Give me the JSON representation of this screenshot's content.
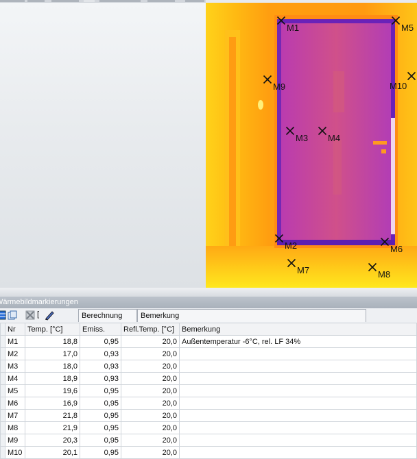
{
  "thermal_image": {
    "markers": [
      {
        "id": "M1",
        "label": "M1"
      },
      {
        "id": "M5",
        "label": "M5"
      },
      {
        "id": "M9",
        "label": "M9"
      },
      {
        "id": "M10",
        "label": "M10"
      },
      {
        "id": "M3",
        "label": "M3"
      },
      {
        "id": "M4",
        "label": "M4"
      },
      {
        "id": "M2",
        "label": "M2"
      },
      {
        "id": "M6",
        "label": "M6"
      },
      {
        "id": "M7",
        "label": "M7"
      },
      {
        "id": "M8",
        "label": "M8"
      }
    ]
  },
  "panel": {
    "title": "Wärmebildmarkierungen"
  },
  "toolbar": {
    "tab_calculation": "Berechnung",
    "tab_remark": "Bemerkung",
    "bracket_glyph": "[",
    "icons": [
      "grid-icon",
      "copy-icon",
      "delete-icon",
      "pen-icon"
    ]
  },
  "table": {
    "columns": [
      "Nr",
      "Temp. [°C]",
      "Emiss.",
      "Refl.Temp. [°C]",
      "Bemerkung"
    ],
    "rows": [
      {
        "nr": "M1",
        "temp": "18,8",
        "emiss": "0,95",
        "refl": "20,0",
        "remark": "Außentemperatur -6°C, rel. LF 34%"
      },
      {
        "nr": "M2",
        "temp": "17,0",
        "emiss": "0,93",
        "refl": "20,0",
        "remark": ""
      },
      {
        "nr": "M3",
        "temp": "18,0",
        "emiss": "0,93",
        "refl": "20,0",
        "remark": ""
      },
      {
        "nr": "M4",
        "temp": "18,9",
        "emiss": "0,93",
        "refl": "20,0",
        "remark": ""
      },
      {
        "nr": "M5",
        "temp": "19,6",
        "emiss": "0,95",
        "refl": "20,0",
        "remark": ""
      },
      {
        "nr": "M6",
        "temp": "16,9",
        "emiss": "0,95",
        "refl": "20,0",
        "remark": ""
      },
      {
        "nr": "M7",
        "temp": "21,8",
        "emiss": "0,95",
        "refl": "20,0",
        "remark": ""
      },
      {
        "nr": "M8",
        "temp": "21,9",
        "emiss": "0,95",
        "refl": "20,0",
        "remark": ""
      },
      {
        "nr": "M9",
        "temp": "20,3",
        "emiss": "0,95",
        "refl": "20,0",
        "remark": ""
      },
      {
        "nr": "M10",
        "temp": "20,1",
        "emiss": "0,95",
        "refl": "20,0",
        "remark": ""
      }
    ]
  },
  "colors": {
    "thermal_hot": "#ffe600",
    "thermal_warm": "#ff9a10",
    "thermal_door": "#c8469a",
    "thermal_cold": "#6a22b8",
    "header_bg": "#adb5bf"
  }
}
